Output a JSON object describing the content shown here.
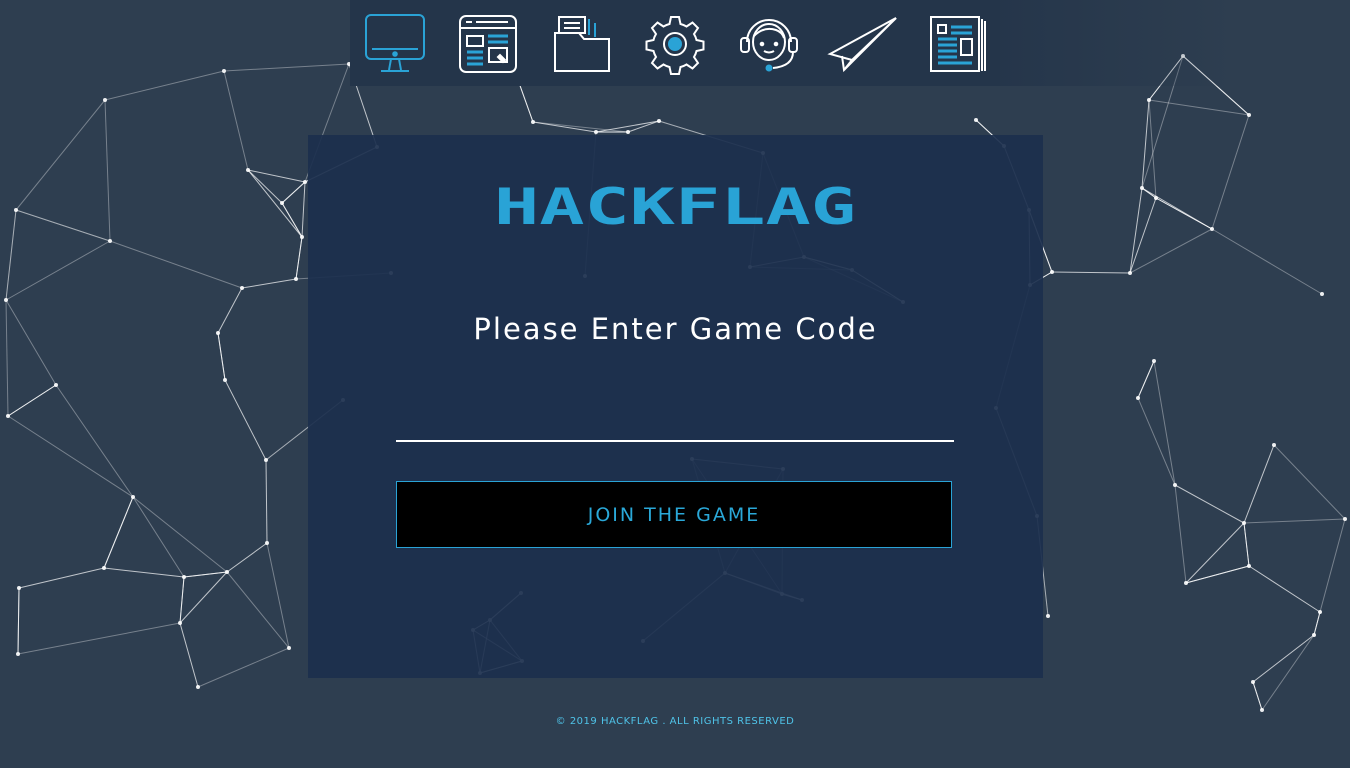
{
  "brand": {
    "logo_text": "HACKFLAG",
    "accent_color": "#29a3d6"
  },
  "nav": {
    "items": [
      {
        "icon": "monitor-icon",
        "active": true
      },
      {
        "icon": "web-layout-icon",
        "active": false
      },
      {
        "icon": "folder-documents-icon",
        "active": false
      },
      {
        "icon": "gear-icon",
        "active": false
      },
      {
        "icon": "headset-support-icon",
        "active": false
      },
      {
        "icon": "paper-plane-icon",
        "active": false
      },
      {
        "icon": "newspaper-icon",
        "active": false
      }
    ]
  },
  "form": {
    "prompt": "Please Enter Game Code",
    "code_value": "",
    "code_placeholder": "",
    "join_label": "JOIN THE GAME"
  },
  "footer": {
    "copyright": "© 2019  HACKFLAG . ALL RIGHTS RESERVED"
  },
  "colors": {
    "background": "#2e3e50",
    "panel": "#1c2f4e",
    "button_bg": "#000000",
    "button_text": "#2aa8d8",
    "footer_text": "#4fc3e8"
  }
}
